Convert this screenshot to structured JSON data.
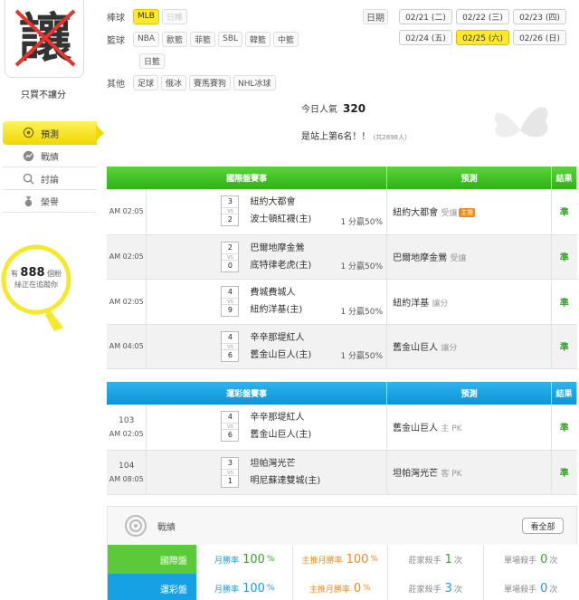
{
  "sidebar": {
    "avatar_glyph": "讓",
    "avatar_caption": "只買不讓分",
    "nav": [
      {
        "label": "預測",
        "active": true
      },
      {
        "label": "戰績",
        "active": false
      },
      {
        "label": "討論",
        "active": false
      },
      {
        "label": "榮譽",
        "active": false
      }
    ],
    "fans_prefix": "有",
    "fans_count": "888",
    "fans_unit": "個粉",
    "fans_suffix": "絲正在追蹤你"
  },
  "filters": {
    "baseball_label": "棒球",
    "baseball": [
      {
        "label": "MLB",
        "state": "active"
      },
      {
        "label": "日棒",
        "state": "disabled"
      }
    ],
    "basketball_label": "籃球",
    "basketball": [
      "NBA",
      "歐籃",
      "菲籃",
      "SBL",
      "韓籃",
      "中籃",
      "日籃"
    ],
    "other_label": "其他",
    "other": [
      "足球",
      "俄冰",
      "賽馬賽狗",
      "NHL冰球"
    ]
  },
  "dates": {
    "label": "日期",
    "items": [
      {
        "label": "02/21 (二)",
        "active": false
      },
      {
        "label": "02/22 (三)",
        "active": false
      },
      {
        "label": "02/23 (四)",
        "active": false
      },
      {
        "label": "02/24 (五)",
        "active": false
      },
      {
        "label": "02/25 (六)",
        "active": true
      },
      {
        "label": "02/26 (日)",
        "active": false
      }
    ]
  },
  "popularity": {
    "label": "今日人氣",
    "value": "320",
    "rank_text": "是站上第6名！！",
    "rank_total": "(共2898人)"
  },
  "intl_table": {
    "headers": [
      "國際盤賽事",
      "預測",
      "結果"
    ],
    "rows": [
      {
        "time": "AM 02:05",
        "s1": "3",
        "s2": "2",
        "team1": "紐約大都會",
        "team2": "波士頓紅襪(主)",
        "handicap": "1 分贏50%",
        "pick": "紐約大都會",
        "pick_sub": "受讓",
        "badge": "主推",
        "result": "準"
      },
      {
        "time": "AM 02:05",
        "s1": "2",
        "s2": "0",
        "team1": "巴爾地摩金鶯",
        "team2": "底特律老虎(主)",
        "handicap": "1 分贏50%",
        "pick": "巴爾地摩金鶯",
        "pick_sub": "受讓",
        "badge": "",
        "result": "準"
      },
      {
        "time": "AM 02:05",
        "s1": "4",
        "s2": "9",
        "team1": "費城費城人",
        "team2": "紐約洋基(主)",
        "handicap": "1 分贏50%",
        "pick": "紐約洋基",
        "pick_sub": "讓分",
        "badge": "",
        "result": "準"
      },
      {
        "time": "AM 04:05",
        "s1": "4",
        "s2": "6",
        "team1": "辛辛那堤紅人",
        "team2": "舊金山巨人(主)",
        "handicap": "1 分贏50%",
        "pick": "舊金山巨人",
        "pick_sub": "讓分",
        "badge": "",
        "result": "準"
      }
    ]
  },
  "lottery_table": {
    "headers": [
      "運彩盤賽事",
      "預測",
      "結果"
    ],
    "rows": [
      {
        "no": "103",
        "time": "AM 02:05",
        "s1": "4",
        "s2": "6",
        "team1": "辛辛那堤紅人",
        "team2": "舊金山巨人(主)",
        "pick": "舊金山巨人",
        "pick_sub": "主 PK",
        "result": "準"
      },
      {
        "no": "104",
        "time": "AM 08:05",
        "s1": "3",
        "s2": "1",
        "team1": "坦帕灣光芒",
        "team2": "明尼蘇達雙城(主)",
        "pick": "坦帕灣光芒",
        "pick_sub": "客 PK",
        "result": "準"
      }
    ]
  },
  "stats": {
    "title": "戰績",
    "see_all": "看全部",
    "rows": [
      {
        "tag": "國際盤",
        "color": "#5cc93b",
        "month_label": "月勝率",
        "month_val": "100",
        "push_label": "主推月勝率",
        "push_val": "100",
        "dealer_label": "莊家殺手",
        "dealer_val": "1",
        "single_label": "單場殺手",
        "single_val": "0",
        "unit_pct": "%",
        "unit_times": "次"
      },
      {
        "tag": "運彩盤",
        "color": "#15a1e4",
        "month_label": "月勝率",
        "month_val": "100",
        "push_label": "主推月勝率",
        "push_val": "0",
        "dealer_label": "莊家殺手",
        "dealer_val": "3",
        "single_label": "單場殺手",
        "single_val": "0",
        "unit_pct": "%",
        "unit_times": "次"
      }
    ]
  }
}
